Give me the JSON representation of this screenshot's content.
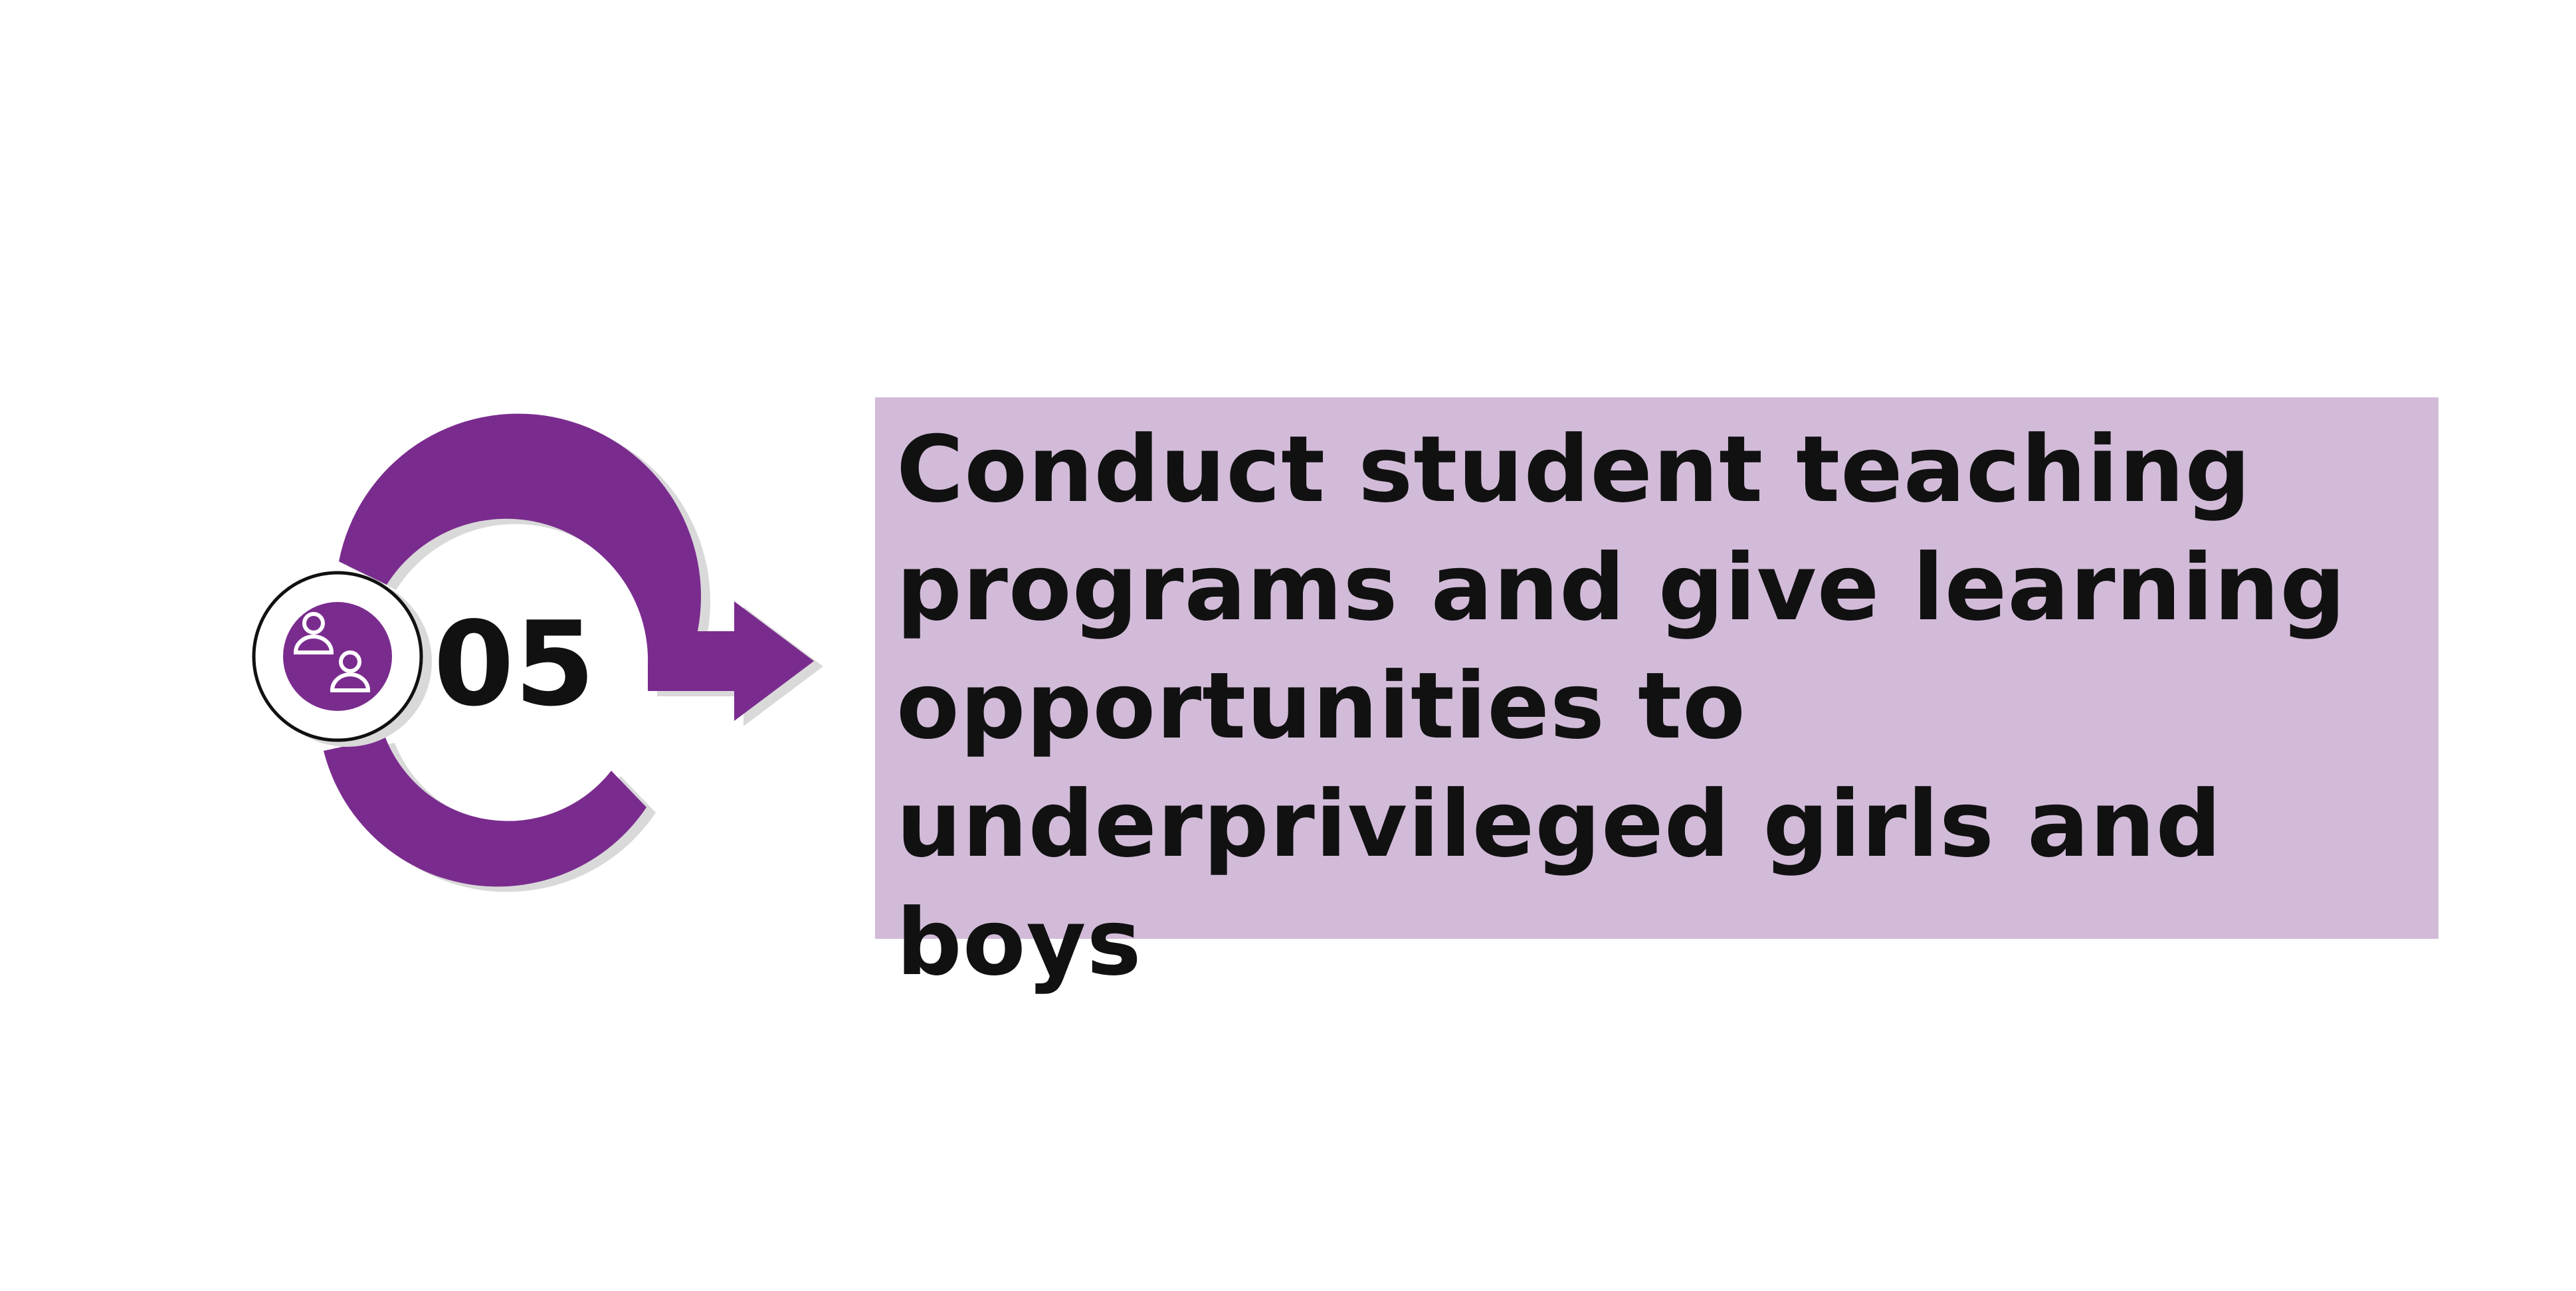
{
  "step": {
    "number": "05",
    "text": "Conduct student teaching programs and give learning opportunities to underprivileged girls and boys",
    "icon": "people-icon"
  },
  "colors": {
    "accent": "#7a2c8e",
    "box_fill": "#d2bbd9",
    "shadow": "#d9d9d9",
    "text": "#111111",
    "icon_line": "#ffffff"
  }
}
